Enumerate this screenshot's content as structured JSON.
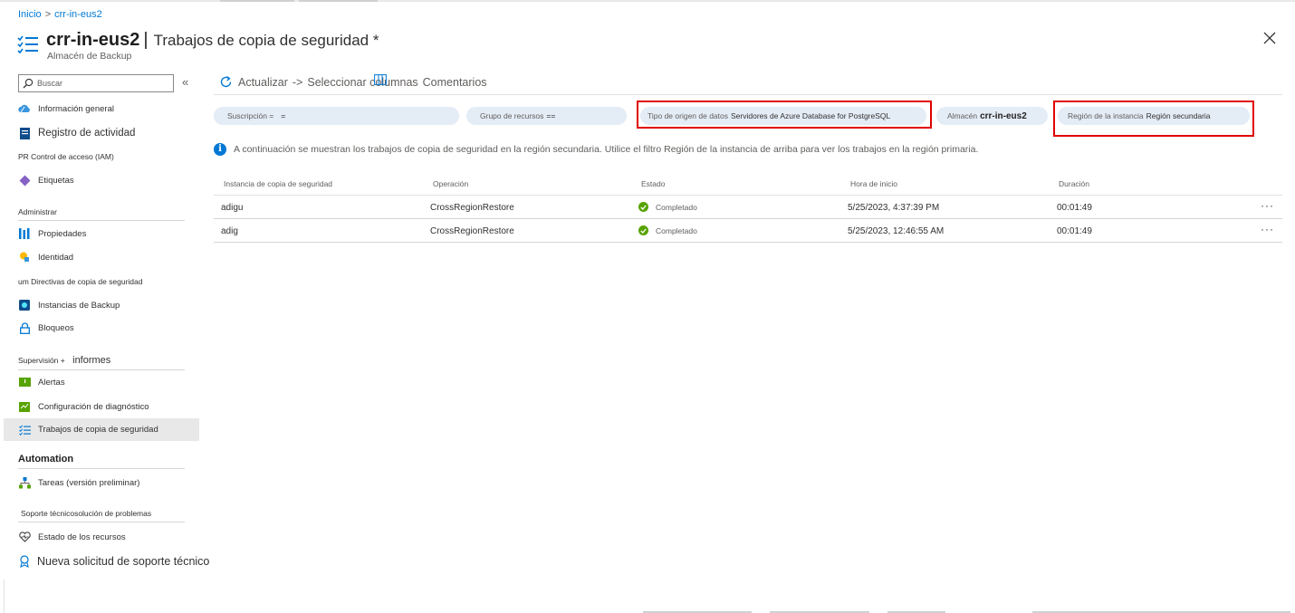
{
  "breadcrumb": {
    "home": "Inicio",
    "separator": ">",
    "current": "crr-in-eus2"
  },
  "header": {
    "title": "crr-in-eus2",
    "divider": "|",
    "subtitle": "Trabajos de copia de seguridad *",
    "caption": "Almacén de Backup",
    "close_icon": "close-icon"
  },
  "sidebar": {
    "search_placeholder": "Buscar",
    "collapse_label": "«",
    "items_top": [
      {
        "label": "Información general",
        "icon": "cloud-icon"
      },
      {
        "label": "Registro de actividad",
        "icon": "log-icon"
      },
      {
        "label": "PR Control de acceso (IAM)",
        "icon": ""
      },
      {
        "label": "Etiquetas",
        "icon": "tag-icon"
      }
    ],
    "section_admin": "Administrar",
    "items_admin": [
      {
        "label": "Propiedades",
        "icon": "properties-icon"
      },
      {
        "label": "Identidad",
        "icon": "identity-icon"
      },
      {
        "label": "um Directivas de copia de seguridad",
        "icon": ""
      },
      {
        "label": "Instancias de Backup",
        "icon": "backup-instance-icon"
      },
      {
        "label": "Bloqueos",
        "icon": "lock-icon"
      }
    ],
    "section_monitoring": "Supervisión +",
    "section_monitoring_extra": "informes",
    "items_monitoring": [
      {
        "label": "Alertas",
        "icon": "alert-icon"
      },
      {
        "label": "Configuración de diagnóstico",
        "icon": "diagnostic-icon"
      },
      {
        "label": "Trabajos de copia de seguridad",
        "icon": "jobs-icon"
      }
    ],
    "section_automation": "Automation",
    "items_automation": [
      {
        "label": "Tareas (versión preliminar)",
        "icon": "tasks-icon"
      }
    ],
    "section_support": "Soporte técnicosolución de problemas",
    "items_support": [
      {
        "label": "Estado de los recursos",
        "icon": "heart-icon"
      },
      {
        "label": "Nueva solicitud de soporte técnico",
        "icon": "support-icon"
      }
    ]
  },
  "commandbar": {
    "refresh_label": "Actualizar",
    "arrow": "->",
    "columns_label": "Seleccionar columnas",
    "feedback_label": "Comentarios"
  },
  "filters": [
    {
      "label": "Suscripción =",
      "value": "="
    },
    {
      "label": "Grupo de recursos",
      "value": "=="
    },
    {
      "label": "Tipo de origen de datos",
      "value": "Servidores de Azure Database for PostgreSQL"
    },
    {
      "label": "Almacén",
      "value": "crr-in-eus2"
    },
    {
      "label": "Región de la instancia",
      "value": "Región secundaria"
    }
  ],
  "info_message": "A continuación se muestran los trabajos de copia de seguridad en la región secundaria. Utilice el filtro Región de la instancia de arriba para ver los trabajos en la región primaria.",
  "table": {
    "columns": [
      "Instancia de copia de seguridad",
      "Operación",
      "Estado",
      "Hora de inicio",
      "Duración"
    ],
    "rows": [
      {
        "instance": "adigu",
        "operation": "CrossRegionRestore",
        "status": "Completado",
        "start": "5/25/2023, 4:37:39 PM",
        "duration": "00:01:49",
        "more": "···"
      },
      {
        "instance": "adig",
        "operation": "CrossRegionRestore",
        "status": "Completado",
        "start": "5/25/2023, 12:46:55 AM",
        "duration": "00:01:49",
        "more": "···"
      }
    ]
  },
  "colors": {
    "accent": "#0078d4",
    "highlight_border": "#e00000",
    "success": "#57a300",
    "pill_bg": "#e4ecf6"
  }
}
